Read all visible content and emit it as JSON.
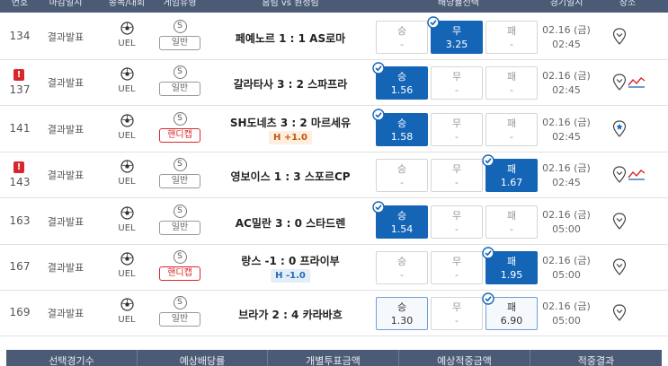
{
  "header": {
    "columns": [
      "번호",
      "마감일시",
      "종목/대회",
      "게임유형",
      "홈팀 vs 원정팀",
      "배당률선택",
      "경기일시",
      "장소"
    ]
  },
  "rows": [
    {
      "no": "134",
      "alert": false,
      "status": "결과발표",
      "league": "UEL",
      "type": "일반",
      "handicap": false,
      "match": "페예노르 1 : 1 AS로마",
      "hc": "",
      "odds": [
        {
          "label": "승",
          "value": "-",
          "state": "none"
        },
        {
          "label": "무",
          "value": "3.25",
          "state": "sel"
        },
        {
          "label": "패",
          "value": "-",
          "state": "none"
        }
      ],
      "date": "02.16 (금)",
      "time": "02:45",
      "trend": false,
      "pin_star": false
    },
    {
      "no": "137",
      "alert": true,
      "status": "결과발표",
      "league": "UEL",
      "type": "일반",
      "handicap": false,
      "match": "갈라타사 3 : 2 스파프라",
      "hc": "",
      "odds": [
        {
          "label": "승",
          "value": "1.56",
          "state": "sel"
        },
        {
          "label": "무",
          "value": "-",
          "state": "none"
        },
        {
          "label": "패",
          "value": "-",
          "state": "none"
        }
      ],
      "date": "02.16 (금)",
      "time": "02:45",
      "trend": true,
      "pin_star": false
    },
    {
      "no": "141",
      "alert": false,
      "status": "결과발표",
      "league": "UEL",
      "type": "핸디캡",
      "handicap": true,
      "match": "SH도네츠 3 : 2 마르세유",
      "hc": "H +1.0",
      "hc_kind": "pos",
      "odds": [
        {
          "label": "승",
          "value": "1.58",
          "state": "sel"
        },
        {
          "label": "무",
          "value": "-",
          "state": "none"
        },
        {
          "label": "패",
          "value": "-",
          "state": "none"
        }
      ],
      "date": "02.16 (금)",
      "time": "02:45",
      "trend": false,
      "pin_star": true
    },
    {
      "no": "143",
      "alert": true,
      "status": "결과발표",
      "league": "UEL",
      "type": "일반",
      "handicap": false,
      "match": "영보이스 1 : 3 스포르CP",
      "hc": "",
      "odds": [
        {
          "label": "승",
          "value": "-",
          "state": "none"
        },
        {
          "label": "무",
          "value": "-",
          "state": "none"
        },
        {
          "label": "패",
          "value": "1.67",
          "state": "sel"
        }
      ],
      "date": "02.16 (금)",
      "time": "02:45",
      "trend": true,
      "pin_star": false
    },
    {
      "no": "163",
      "alert": false,
      "status": "결과발표",
      "league": "UEL",
      "type": "일반",
      "handicap": false,
      "match": "AC밀란 3 : 0 스타드렌",
      "hc": "",
      "odds": [
        {
          "label": "승",
          "value": "1.54",
          "state": "sel"
        },
        {
          "label": "무",
          "value": "-",
          "state": "none"
        },
        {
          "label": "패",
          "value": "-",
          "state": "none"
        }
      ],
      "date": "02.16 (금)",
      "time": "05:00",
      "trend": false,
      "pin_star": false
    },
    {
      "no": "167",
      "alert": false,
      "status": "결과발표",
      "league": "UEL",
      "type": "핸디캡",
      "handicap": true,
      "match": "랑스 -1 : 0 프라이부",
      "hc": "H -1.0",
      "hc_kind": "neg",
      "odds": [
        {
          "label": "승",
          "value": "-",
          "state": "none"
        },
        {
          "label": "무",
          "value": "-",
          "state": "none"
        },
        {
          "label": "패",
          "value": "1.95",
          "state": "sel"
        }
      ],
      "date": "02.16 (금)",
      "time": "05:00",
      "trend": false,
      "pin_star": false
    },
    {
      "no": "169",
      "alert": false,
      "status": "결과발표",
      "league": "UEL",
      "type": "일반",
      "handicap": false,
      "match": "브라가 2 : 4 카라바흐",
      "hc": "",
      "odds": [
        {
          "label": "승",
          "value": "1.30",
          "state": "win"
        },
        {
          "label": "무",
          "value": "-",
          "state": "none"
        },
        {
          "label": "패",
          "value": "6.90",
          "state": "win-check"
        }
      ],
      "date": "02.16 (금)",
      "time": "05:00",
      "trend": false,
      "pin_star": false
    }
  ],
  "summary": {
    "cells": [
      "선택경기수",
      "예상배당률",
      "개별투표금액",
      "예상적중금액",
      "적중결과"
    ]
  },
  "colors": {
    "header_bg": "#4b5a75",
    "selected": "#1565b7",
    "alert": "#d9272e",
    "handicap": "#d9272e"
  }
}
